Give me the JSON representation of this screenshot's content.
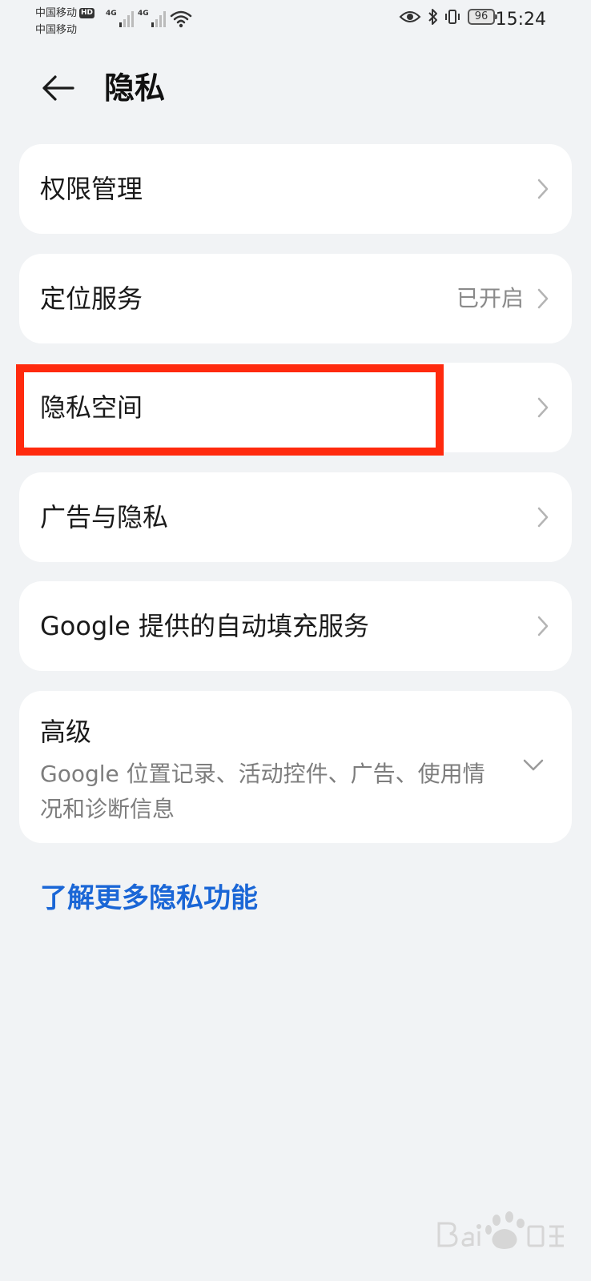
{
  "status_bar": {
    "carrier_1": "中国移动",
    "carrier_2": "中国移动",
    "hd_badge": "HD",
    "network_1": "4G",
    "network_2": "4G",
    "battery_level": "96",
    "time": "15:24",
    "icons": [
      "signal-icon",
      "wifi-icon",
      "eye-icon",
      "bluetooth-icon",
      "vibrate-icon",
      "battery-icon"
    ]
  },
  "header": {
    "title": "隐私",
    "back_icon": "back-arrow-icon"
  },
  "settings": {
    "permission": {
      "label": "权限管理"
    },
    "location": {
      "label": "定位服务",
      "value": "已开启"
    },
    "private_space": {
      "label": "隐私空间"
    },
    "ads_privacy": {
      "label": "广告与隐私"
    },
    "google_autofill": {
      "label": "Google 提供的自动填充服务"
    },
    "advanced": {
      "label": "高级",
      "description": "Google 位置记录、活动控件、广告、使用情况和诊断信息"
    }
  },
  "link": {
    "learn_more": "了解更多隐私功能"
  },
  "colors": {
    "background": "#f1f3f5",
    "card": "#ffffff",
    "link": "#1a66d6",
    "highlight": "#ff2a0e",
    "secondary_text": "#8a8a8a"
  }
}
